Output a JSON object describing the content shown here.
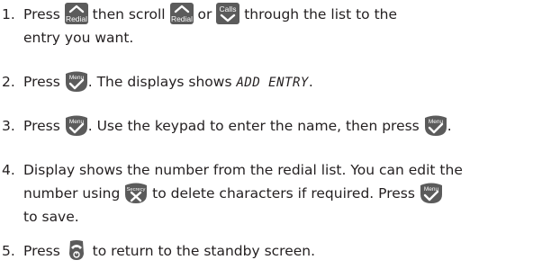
{
  "steps": [
    {
      "number": "1.",
      "parts": {
        "t1": "Press",
        "t2": "then scroll",
        "t3": "or",
        "t4": "through the list to the",
        "t5": "entry you want."
      }
    },
    {
      "number": "2.",
      "parts": {
        "t1": "Press",
        "t2": ". The displays shows",
        "lcd": "ADD ENTRY",
        "t3": "."
      }
    },
    {
      "number": "3.",
      "parts": {
        "t1": "Press",
        "t2": ". Use the keypad to enter the name, then press",
        "t3": "."
      }
    },
    {
      "number": "4.",
      "parts": {
        "t1": "Display shows the number from the redial list. You can edit the",
        "t2": "number using",
        "t3": "to delete characters if required. Press",
        "t4": "to save."
      }
    },
    {
      "number": "5.",
      "parts": {
        "t1": "Press",
        "t2": "to return to the standby screen."
      }
    }
  ],
  "keys": {
    "redial": "Redial",
    "calls": "Calls",
    "menu": "Menu",
    "secrecy": "Secrecy"
  },
  "icons": {
    "redial": "chevron-up-icon",
    "calls": "chevron-down-icon",
    "menu": "check-icon",
    "secrecy": "cross-icon",
    "end_call": "handset-icon"
  },
  "colors": {
    "text": "#231f20",
    "key_fill": "#5b5b5b"
  }
}
